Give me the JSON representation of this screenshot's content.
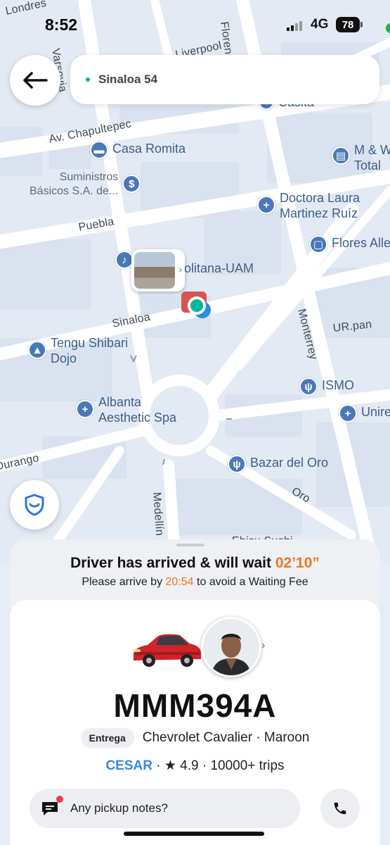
{
  "status_bar": {
    "time": "8:52",
    "network": "4G",
    "battery": "78"
  },
  "top": {
    "destination": "Sinaloa 54"
  },
  "map": {
    "streets": [
      "Av. Chapultepec",
      "Puebla",
      "Sinaloa",
      "Monterrey",
      "Medellín",
      "Durango",
      "Oro",
      "Varsovia",
      "Florencia",
      "Liverpool",
      "Londres",
      "Ebisu Sushi",
      "UR.pan"
    ],
    "pois": [
      {
        "label": "Casa Romita",
        "icon": "hotel-icon"
      },
      {
        "label": "Suministros\nBásicos S.A. de...",
        "icon": "dollar-icon"
      },
      {
        "label": "Doctora Laura\nMartinez Ruíz",
        "icon": "plus-icon"
      },
      {
        "label": "Flores Alle",
        "icon": "bag-icon"
      },
      {
        "label": "M & W\nTotal",
        "icon": "doc-icon"
      },
      {
        "label": "Tengu Shibari\nDojo",
        "icon": "school-icon"
      },
      {
        "label": "Albanta\nAesthetic Spa",
        "icon": "plus-icon"
      },
      {
        "label": "ISMO",
        "icon": "restaurant-icon"
      },
      {
        "label": "Unire",
        "icon": "plus-icon"
      },
      {
        "label": "Bazar del Oro",
        "icon": "restaurant-icon"
      },
      {
        "label": "olitana-UAM",
        "icon": "music-icon"
      },
      {
        "label": "Casita",
        "icon": "place-icon"
      }
    ]
  },
  "sheet": {
    "title_prefix": "Driver has arrived & will wait ",
    "timer": "02’10”",
    "sub_prefix": "Please arrive by ",
    "sub_time": "20:54",
    "sub_suffix": " to avoid a Waiting Fee",
    "plate": "MMM394A",
    "service": "Entrega",
    "vehicle": "Chevrolet Cavalier · Maroon",
    "driver_name": "CESAR",
    "rating_text": " · ★ 4.9 · 10000+ trips",
    "notes_placeholder": "Any pickup notes?"
  },
  "colors": {
    "accent_orange": "#f0771f",
    "driver_blue": "#3a86e0",
    "map_blue": "#4a79b8",
    "teal": "#00b1a0"
  }
}
